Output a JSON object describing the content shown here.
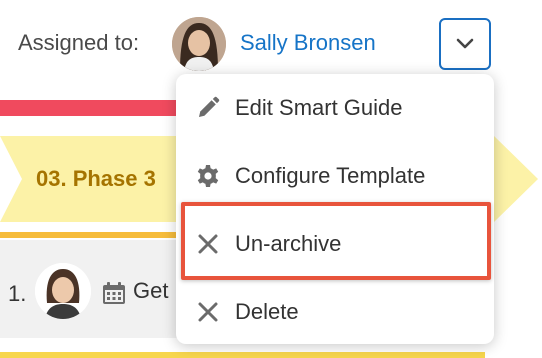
{
  "header": {
    "assigned_label": "Assigned to:",
    "assignee_name": "Sally Bronsen"
  },
  "phase": {
    "label": "03. Phase 3"
  },
  "task": {
    "number": "1.",
    "text": "Get"
  },
  "menu": {
    "items": [
      {
        "label": "Edit Smart Guide",
        "icon": "pencil-icon"
      },
      {
        "label": "Configure Template",
        "icon": "gear-icon"
      },
      {
        "label": "Un-archive",
        "icon": "close-icon",
        "highlighted": true
      },
      {
        "label": "Delete",
        "icon": "close-icon"
      }
    ]
  },
  "colors": {
    "link": "#1674c7",
    "phase_bg": "#fcf2a7",
    "phase_text": "#a57400",
    "red_bar": "#f04a5e",
    "highlight": "#e8543c"
  }
}
